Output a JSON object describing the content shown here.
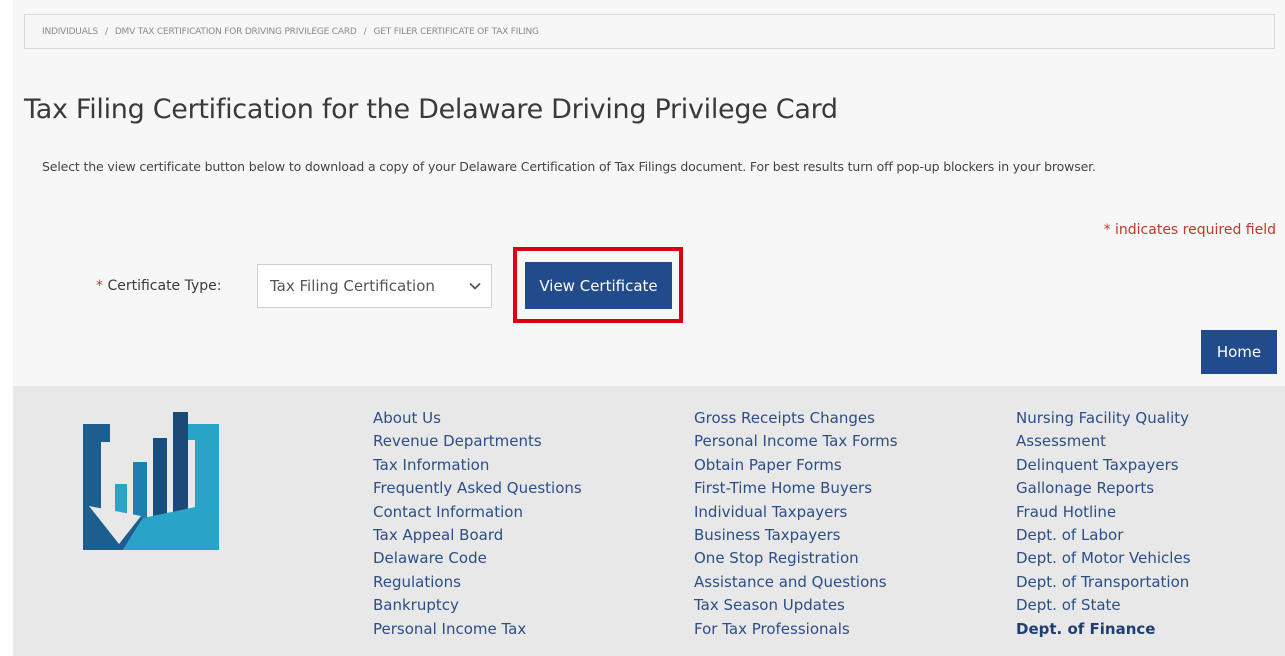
{
  "breadcrumb": {
    "items": [
      "INDIVIDUALS",
      "DMV TAX CERTIFICATION FOR DRIVING PRIVILEGE CARD",
      "GET FILER CERTIFICATE OF TAX FILING"
    ],
    "separator": "/"
  },
  "page": {
    "title": "Tax Filing Certification for the Delaware Driving Privilege Card",
    "instructions": "Select the view certificate button below to download a copy of your Delaware Certification of Tax Filings document. For best results turn off pop-up blockers in your browser.",
    "required_note": "* indicates required field"
  },
  "form": {
    "required_marker": "*",
    "certificate_type_label": "Certificate Type:",
    "certificate_type_value": "Tax Filing Certification",
    "view_button": "View Certificate",
    "home_button": "Home"
  },
  "footer": {
    "logo_icon": "delaware-revenue-logo",
    "col1": [
      "About Us",
      "Revenue Departments",
      "Tax Information",
      "Frequently Asked Questions",
      "Contact Information",
      "Tax Appeal Board",
      "Delaware Code",
      "Regulations",
      "Bankruptcy",
      "Personal Income Tax"
    ],
    "col2": [
      "Gross Receipts Changes",
      "Personal Income Tax Forms",
      "Obtain Paper Forms",
      "First-Time Home Buyers",
      "Individual Taxpayers",
      "Business Taxpayers",
      "One Stop Registration",
      "Assistance and Questions",
      "Tax Season Updates",
      "For Tax Professionals"
    ],
    "col3": [
      "Nursing Facility Quality",
      "Assessment",
      "Delinquent Taxpayers",
      "Gallonage Reports",
      "Fraud Hotline",
      "Dept. of Labor",
      "Dept. of Motor Vehicles",
      "Dept. of Transportation",
      "Dept. of State",
      "Dept. of Finance"
    ]
  },
  "colors": {
    "primary_button": "#224b8b",
    "required_red": "#c0392b",
    "highlight_red": "#e0000d",
    "link_blue": "#2c4e86"
  }
}
